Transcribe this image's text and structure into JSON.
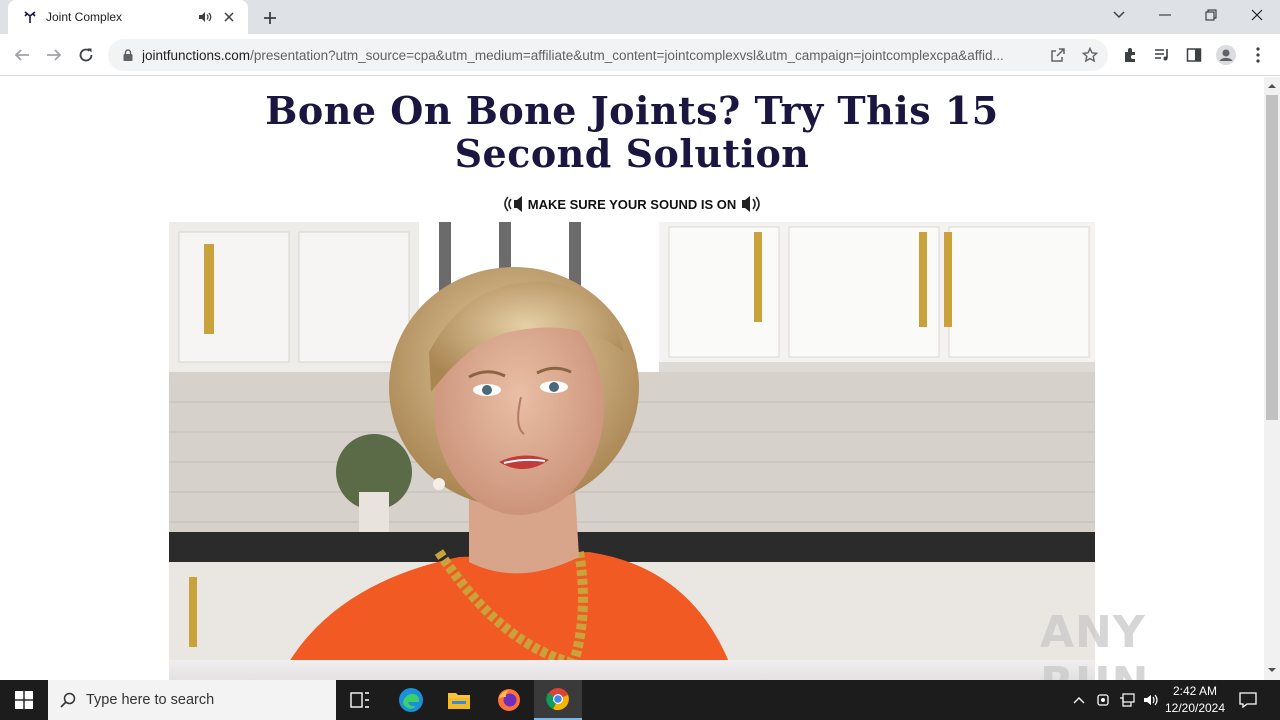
{
  "browser": {
    "tab": {
      "title": "Joint Complex"
    },
    "url": {
      "host": "jointfunctions.com",
      "path": "/presentation?utm_source=cpa&utm_medium=affiliate&utm_content=jointcomplexvsl&utm_campaign=jointcomplexcpa&affid..."
    }
  },
  "page": {
    "headline": "Bone On Bone Joints? Try This 15 Second Solution",
    "sound_notice": "MAKE SURE YOUR SOUND IS ON",
    "watermark": "ANY RUN"
  },
  "taskbar": {
    "search_placeholder": "Type here to search",
    "time": "2:42 AM",
    "date": "12/20/2024"
  },
  "colors": {
    "headline": "#1a1640",
    "taskbar": "#1c1c1c",
    "tabstrip": "#dee1e6"
  }
}
